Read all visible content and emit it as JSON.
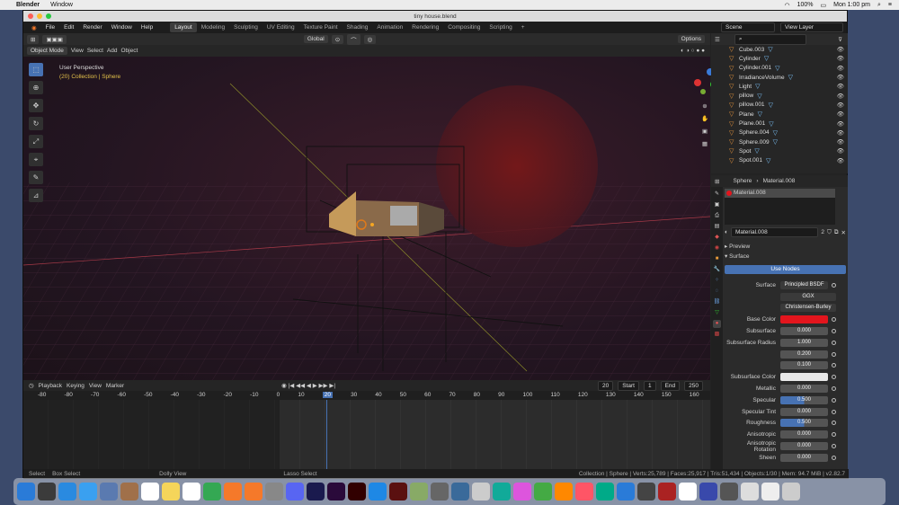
{
  "mac": {
    "app": "Blender",
    "menu": "Window",
    "clock": "Mon 1:00 pm",
    "battery": "100%"
  },
  "window_title": "tiny house.blend",
  "menus": [
    "File",
    "Edit",
    "Render",
    "Window",
    "Help"
  ],
  "workspaces": [
    "Layout",
    "Modeling",
    "Sculpting",
    "UV Editing",
    "Texture Paint",
    "Shading",
    "Animation",
    "Rendering",
    "Compositing",
    "Scripting"
  ],
  "scene": "Scene",
  "view_layer": "View Layer",
  "viewport": {
    "mode": "Object Mode",
    "view": "View",
    "select": "Select",
    "add": "Add",
    "object": "Object",
    "orientation": "Global",
    "options": "Options",
    "persp": "User Perspective",
    "collection": "(20) Collection | Sphere"
  },
  "outliner": [
    {
      "name": "Cube.003",
      "eye": "👁"
    },
    {
      "name": "Cylinder",
      "eye": "👁"
    },
    {
      "name": "Cylinder.001",
      "eye": "👁"
    },
    {
      "name": "IrradianceVolume",
      "eye": "👁"
    },
    {
      "name": "Light",
      "eye": "👁"
    },
    {
      "name": "pillow",
      "eye": "👁"
    },
    {
      "name": "pillow.001",
      "eye": "👁"
    },
    {
      "name": "Plane",
      "eye": "👁"
    },
    {
      "name": "Plane.001",
      "eye": "👁"
    },
    {
      "name": "Sphere.004",
      "eye": "👁"
    },
    {
      "name": "Sphere.009",
      "eye": "👁"
    },
    {
      "name": "Spot",
      "eye": "👁"
    },
    {
      "name": "Spot.001",
      "eye": "👁"
    }
  ],
  "props": {
    "object": "Sphere",
    "material": "Material.008",
    "slot": "Material.008",
    "users": "2",
    "preview": "Preview",
    "surface_panel": "Surface",
    "use_nodes": "Use Nodes",
    "surface_label": "Surface",
    "surface_val": "Principled BSDF",
    "dist": "GGX",
    "sss_method": "Christensen-Burley",
    "rows": [
      {
        "label": "Base Color",
        "value": "",
        "color": "#e3151d"
      },
      {
        "label": "Subsurface",
        "value": "0.000"
      },
      {
        "label": "Subsurface Radius",
        "value": "1.000"
      },
      {
        "label": "",
        "value": "0.200"
      },
      {
        "label": "",
        "value": "0.100"
      },
      {
        "label": "Subsurface Color",
        "value": "",
        "color": "#e8e8e8"
      },
      {
        "label": "Metallic",
        "value": "0.000"
      },
      {
        "label": "Specular",
        "value": "0.500",
        "fill": true
      },
      {
        "label": "Specular Tint",
        "value": "0.000"
      },
      {
        "label": "Roughness",
        "value": "0.500",
        "fill": true
      },
      {
        "label": "Anisotropic",
        "value": "0.000"
      },
      {
        "label": "Anisotropic Rotation",
        "value": "0.000"
      },
      {
        "label": "Sheen",
        "value": "0.000"
      }
    ]
  },
  "timeline": {
    "playback": "Playback",
    "keying": "Keying",
    "view": "View",
    "marker": "Marker",
    "current": "20",
    "start_label": "Start",
    "start": "1",
    "end_label": "End",
    "end": "250",
    "ticks": [
      "-80",
      "-80",
      "-70",
      "-60",
      "-50",
      "-40",
      "-30",
      "-20",
      "-10",
      "0",
      "10",
      "20",
      "30",
      "40",
      "50",
      "60",
      "70",
      "80",
      "90",
      "100",
      "110",
      "120",
      "130",
      "140",
      "150",
      "160"
    ]
  },
  "status": {
    "select": "Select",
    "box": "Box Select",
    "dolly": "Dolly View",
    "lasso": "Lasso Select",
    "stats": "Collection | Sphere | Verts:25,789 | Faces:25,917 | Tris:51,434 | Objects:1/30 | Mem: 94.7 MiB | v2.82.7"
  }
}
